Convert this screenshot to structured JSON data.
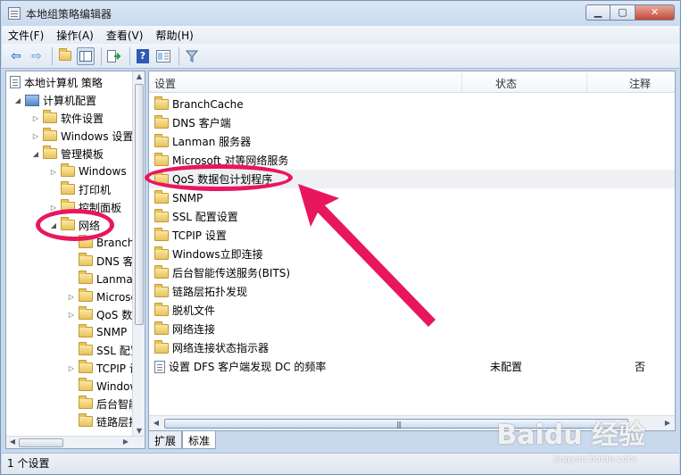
{
  "window": {
    "title": "本地组策略编辑器",
    "controls": {
      "minimize": "▁",
      "maximize": "▢",
      "close": "✕"
    }
  },
  "menu": [
    "文件(F)",
    "操作(A)",
    "查看(V)",
    "帮助(H)"
  ],
  "toolbar": {
    "icons": [
      "back-arrow-icon",
      "forward-arrow-icon",
      "up-folder-icon",
      "show-hide-tree-icon",
      "export-list-icon",
      "help-icon",
      "properties-icon",
      "filter-icon"
    ]
  },
  "tree": {
    "items": [
      {
        "label": "本地计算机 策略",
        "expander": ""
      },
      {
        "label": "计算机配置",
        "expander": "◢"
      },
      {
        "label": "软件设置",
        "expander": "▷"
      },
      {
        "label": "Windows 设置",
        "expander": "▷"
      },
      {
        "label": "管理模板",
        "expander": "◢"
      },
      {
        "label": "Windows",
        "expander": "▷"
      },
      {
        "label": "打印机",
        "expander": ""
      },
      {
        "label": "控制面板",
        "expander": "▷"
      },
      {
        "label": "网络",
        "expander": "◢"
      },
      {
        "label": "BranchCache",
        "expander": ""
      },
      {
        "label": "DNS 客户端",
        "expander": ""
      },
      {
        "label": "Lanman 服务器",
        "expander": ""
      },
      {
        "label": "Microsoft 对等网络服务",
        "expander": "▷"
      },
      {
        "label": "QoS 数据包计划程序",
        "expander": "▷"
      },
      {
        "label": "SNMP",
        "expander": ""
      },
      {
        "label": "SSL 配置设置",
        "expander": ""
      },
      {
        "label": "TCPIP 设置",
        "expander": "▷"
      },
      {
        "label": "Windows立即连接",
        "expander": ""
      },
      {
        "label": "后台智能传送服务(BITS)",
        "expander": ""
      },
      {
        "label": "链路层拓扑发现",
        "expander": ""
      }
    ]
  },
  "list": {
    "columns": {
      "setting": "设置",
      "state": "状态",
      "comment": "注释"
    },
    "rows": [
      {
        "name": "BranchCache",
        "state": "",
        "comment": "",
        "icon": "folder"
      },
      {
        "name": "DNS 客户端",
        "state": "",
        "comment": "",
        "icon": "folder"
      },
      {
        "name": "Lanman 服务器",
        "state": "",
        "comment": "",
        "icon": "folder"
      },
      {
        "name": "Microsoft 对等网络服务",
        "state": "",
        "comment": "",
        "icon": "folder"
      },
      {
        "name": "QoS 数据包计划程序",
        "state": "",
        "comment": "",
        "icon": "folder"
      },
      {
        "name": "SNMP",
        "state": "",
        "comment": "",
        "icon": "folder"
      },
      {
        "name": "SSL 配置设置",
        "state": "",
        "comment": "",
        "icon": "folder"
      },
      {
        "name": "TCPIP 设置",
        "state": "",
        "comment": "",
        "icon": "folder"
      },
      {
        "name": "Windows立即连接",
        "state": "",
        "comment": "",
        "icon": "folder"
      },
      {
        "name": "后台智能传送服务(BITS)",
        "state": "",
        "comment": "",
        "icon": "folder"
      },
      {
        "name": "链路层拓扑发现",
        "state": "",
        "comment": "",
        "icon": "folder"
      },
      {
        "name": "脱机文件",
        "state": "",
        "comment": "",
        "icon": "folder"
      },
      {
        "name": "网络连接",
        "state": "",
        "comment": "",
        "icon": "folder"
      },
      {
        "name": "网络连接状态指示器",
        "state": "",
        "comment": "",
        "icon": "folder"
      },
      {
        "name": "设置 DFS 客户端发现 DC 的频率",
        "state": "未配置",
        "comment": "否",
        "icon": "policy"
      }
    ]
  },
  "tabs": [
    "扩展",
    "标准"
  ],
  "status": "1 个设置",
  "watermark": {
    "main": "Baidu 经验",
    "sub": "jingyan.baidu.com"
  },
  "colors": {
    "annotation": "#e8175d"
  }
}
